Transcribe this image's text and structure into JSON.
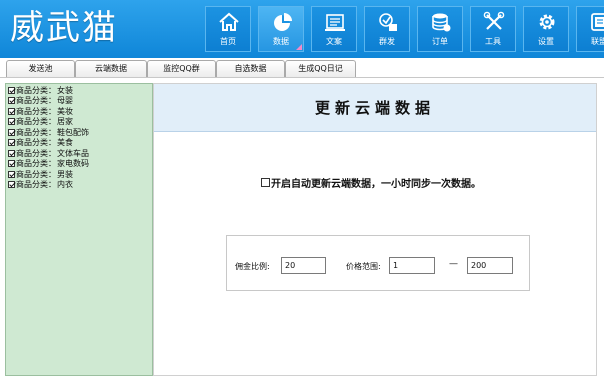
{
  "app": {
    "logo_text": "威武猫"
  },
  "nav": {
    "items": [
      {
        "label": "首页",
        "icon": "home-icon"
      },
      {
        "label": "数据",
        "icon": "pie-chart-icon",
        "active": true
      },
      {
        "label": "文案",
        "icon": "document-icon"
      },
      {
        "label": "群发",
        "icon": "broadcast-icon"
      },
      {
        "label": "订单",
        "icon": "database-icon"
      },
      {
        "label": "工具",
        "icon": "tools-icon"
      },
      {
        "label": "设置",
        "icon": "gear-icon"
      },
      {
        "label": "联盟",
        "icon": "alliance-icon"
      }
    ]
  },
  "tabs": [
    {
      "label": "发送池"
    },
    {
      "label": "云端数据",
      "active": true
    },
    {
      "label": "监控QQ群"
    },
    {
      "label": "自选数据"
    },
    {
      "label": "生成QQ日记"
    }
  ],
  "sidebar": {
    "prefix": "商品分类：",
    "items": [
      {
        "name": "女装",
        "checked": true
      },
      {
        "name": "母婴",
        "checked": true
      },
      {
        "name": "美妆",
        "checked": true
      },
      {
        "name": "居家",
        "checked": true
      },
      {
        "name": "鞋包配饰",
        "checked": true
      },
      {
        "name": "美食",
        "checked": true
      },
      {
        "name": "文体车品",
        "checked": true
      },
      {
        "name": "家电数码",
        "checked": true
      },
      {
        "name": "男装",
        "checked": true
      },
      {
        "name": "内衣",
        "checked": true
      }
    ]
  },
  "main": {
    "title": "更新云端数据",
    "auto_update_label": "开启自动更新云端数据，一小时同步一次数据。",
    "auto_update_checked": false,
    "commission_label": "佣金比例:",
    "commission_value": "20",
    "price_label": "价格范围:",
    "price_min": "1",
    "price_dash": "—",
    "price_max": "200"
  },
  "colors": {
    "header_blue": "#0f86d8",
    "sidebar_green": "#cfe9d2",
    "title_band": "#e1eef9"
  }
}
